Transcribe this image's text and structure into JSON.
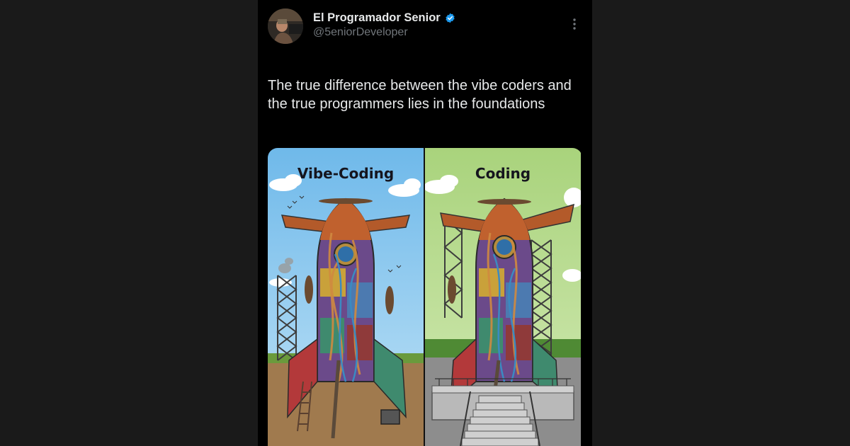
{
  "tweet": {
    "author_name": "El Programador Senior",
    "author_handle": "@5eniorDeveloper",
    "verified": true,
    "text": "The true difference between the vibe coders and the true programmers lies in the foundations"
  },
  "media": {
    "left_panel_title": "Vibe-Coding",
    "right_panel_title": "Coding"
  },
  "colors": {
    "page_bg": "#1a1a1a",
    "tweet_bg": "#000000",
    "text_primary": "#e7e9ea",
    "text_secondary": "#71767b",
    "verified_blue": "#1d9bf0",
    "sky_left": "#7ec3ec",
    "sky_right": "#b3d98b"
  },
  "icons": {
    "verified": "verified-badge-icon",
    "more": "more-options-icon"
  }
}
